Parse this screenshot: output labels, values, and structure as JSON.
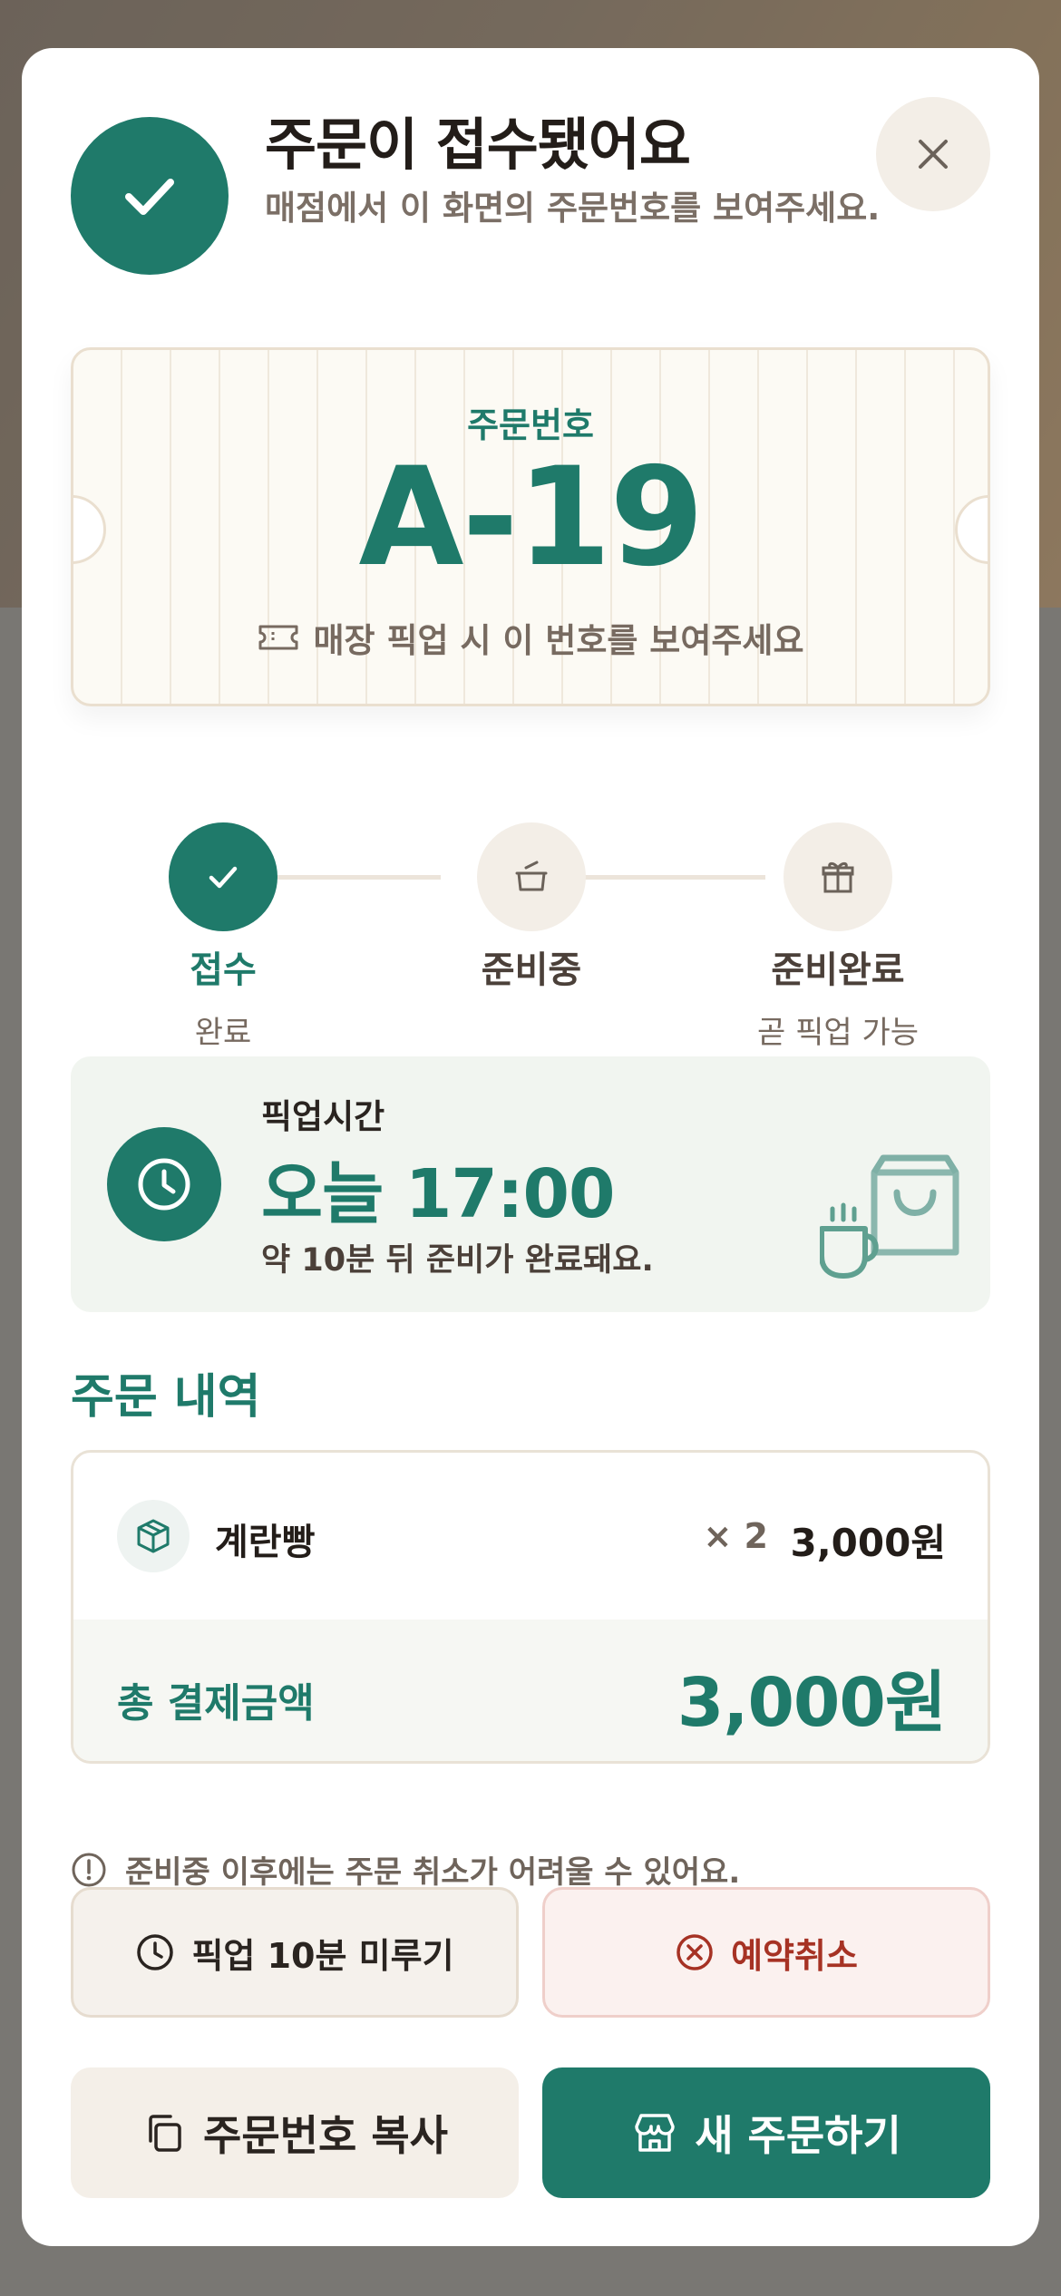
{
  "header": {
    "title": "주문이 접수됐어요",
    "subtitle": "매점에서 이 화면의 주문번호를 보여주세요."
  },
  "ticket": {
    "label": "주문번호",
    "number": "A-19",
    "hint": "매장 픽업 시 이 번호를 보여주세요"
  },
  "steps": [
    {
      "label": "접수",
      "sub": "완료",
      "state": "done",
      "icon": "check-icon"
    },
    {
      "label": "준비중",
      "sub": "",
      "state": "todo",
      "icon": "pot-icon"
    },
    {
      "label": "준비완료",
      "sub": "곧 픽업 가능",
      "state": "todo",
      "icon": "gift-icon"
    }
  ],
  "pickup": {
    "label": "픽업시간",
    "time": "오늘 17:00",
    "note": "약 10분 뒤 준비가 완료돼요."
  },
  "order": {
    "section_title": "주문 내역",
    "items": [
      {
        "name": "계란빵",
        "qty": "× 2",
        "price": "3,000원"
      }
    ],
    "total_label": "총 결제금액",
    "total_value": "3,000원"
  },
  "notice": "준비중 이후에는 주문 취소가 어려울 수 있어요.",
  "buttons": {
    "delay": "픽업 10분 미루기",
    "cancel": "예약취소",
    "copy": "주문번호 복사",
    "new_order": "새 주문하기"
  },
  "colors": {
    "accent": "#1f7a6a",
    "danger": "#a63224",
    "surface": "#f4efe8"
  }
}
